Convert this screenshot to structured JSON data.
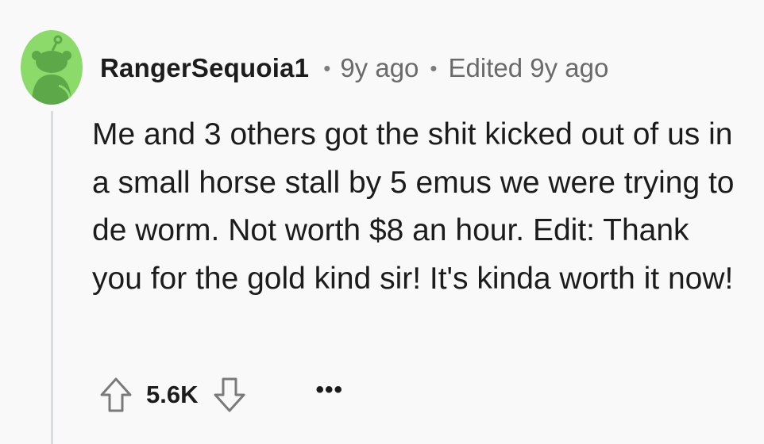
{
  "comment": {
    "author": "RangerSequoia1",
    "timestamp": "9y ago",
    "edited": "Edited 9y ago",
    "separator": "•",
    "body": "Me and 3 others got the shit kicked out of us in a small horse stall by 5 emus we were trying to de worm. Not worth $8 an hour. Edit: Thank you for the gold kind sir! It's kinda worth it now!",
    "score": "5.6K",
    "more_label": "•••",
    "avatar_icon": "snoo-avatar-icon",
    "colors": {
      "avatar_bg": "#8cdb6a",
      "avatar_figure": "#5da94a",
      "text": "#1c1c1c",
      "meta_text": "#6a6a6a",
      "thread_line": "#dadce0",
      "background": "#f9f9fa"
    }
  }
}
